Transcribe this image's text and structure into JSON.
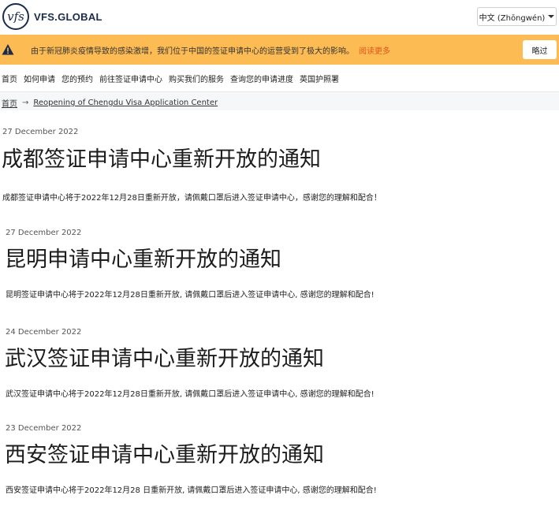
{
  "header": {
    "logo_glyph": "vfs",
    "logo_text": "VFS.GLOBAL",
    "language": "中文 (Zhōngwén)"
  },
  "alert": {
    "text": "由于新冠肺炎疫情导致的感染激增，我们位于中国的签证申请中心的运营受到了极大的影响。",
    "link": "阅读更多",
    "skip": "略过"
  },
  "nav": {
    "items": [
      "首页",
      "如何申请",
      "您的预约",
      "前往签证申请中心",
      "购买我们的服务",
      "查询您的申请进度",
      "英国护照署"
    ]
  },
  "breadcrumb": {
    "home": "首页",
    "separator": "→",
    "current": "Reopening of Chengdu Visa Application Center"
  },
  "articles": [
    {
      "date": "27 December 2022",
      "title": "成都签证申请中心重新开放的通知",
      "body": "成都签证申请中心将于2022年12月28日重新开放，请佩戴口罩后进入签证申请中心，感谢您的理解和配合！"
    },
    {
      "date": "27 December 2022",
      "title": "昆明申请中心重新开放的通知",
      "body": "昆明签证申请中心将于2022年12月28日重新开放, 请佩戴口罩后进入签证申请中心, 感谢您的理解和配合!"
    },
    {
      "date": "24 December 2022",
      "title": "武汉签证申请中心重新开放的通知",
      "body": "武汉签证申请中心将于2022年12月28日重新开放, 请佩戴口罩后进入签证申请中心, 感谢您的理解和配合!"
    },
    {
      "date": "23 December 2022",
      "title": "西安签证申请中心重新开放的通知",
      "body": "西安签证申请中心将于2022年12月28 日重新开放, 请佩戴口罩后进入签证申请中心, 感谢您的理解和配合!"
    }
  ]
}
